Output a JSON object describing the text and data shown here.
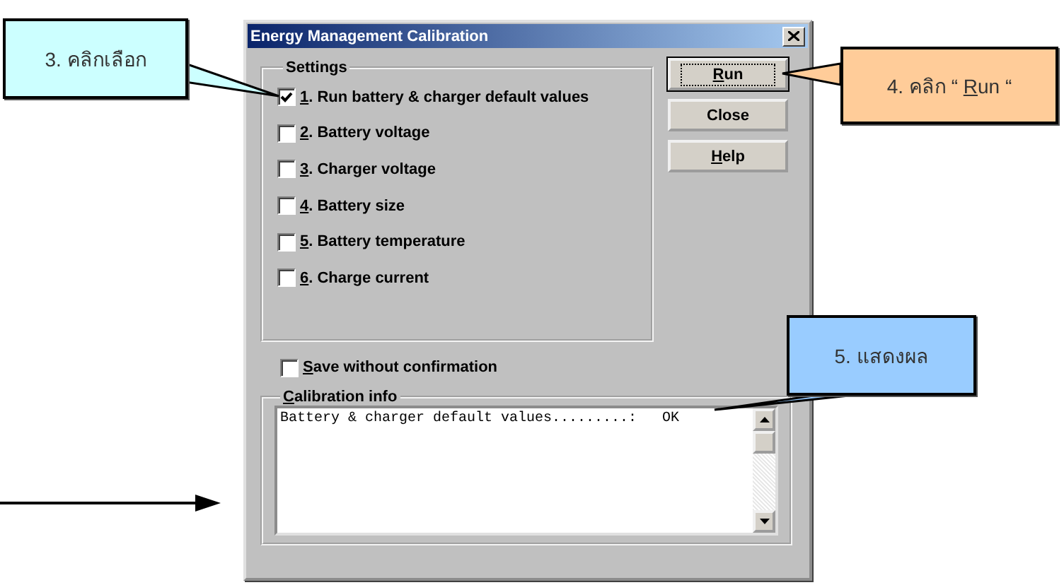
{
  "window": {
    "title": "Energy Management Calibration"
  },
  "settings": {
    "title": "Settings",
    "options": [
      {
        "mnemonic": "1",
        "rest": ". Run battery & charger default values",
        "checked": true
      },
      {
        "mnemonic": "2",
        "rest": ". Battery voltage",
        "checked": false
      },
      {
        "mnemonic": "3",
        "rest": ". Charger voltage",
        "checked": false
      },
      {
        "mnemonic": "4",
        "rest": ". Battery size",
        "checked": false
      },
      {
        "mnemonic": "5",
        "rest": ". Battery temperature",
        "checked": false
      },
      {
        "mnemonic": "6",
        "rest": ". Charge current",
        "checked": false
      }
    ]
  },
  "buttons": [
    {
      "mnemonic": "R",
      "rest": "un",
      "default": true
    },
    {
      "rest": "Close",
      "default": false
    },
    {
      "mnemonic": "H",
      "rest": "elp",
      "default": false
    }
  ],
  "save_option": {
    "mnemonic": "S",
    "rest": "ave without confirmation",
    "checked": false
  },
  "calibration_info": {
    "mnemonic": "C",
    "rest": "alibration info",
    "lines": [
      "Battery & charger default values.........:   OK"
    ]
  },
  "callouts": [
    {
      "lead": "3. คลิกเลือก",
      "color": "#ccffff"
    },
    {
      "lead": "4. คลิก “ ",
      "mnemonic": "R",
      "rest": "un “",
      "color": "#ffcc99"
    },
    {
      "lead": "5. แสดงผล",
      "color": "#99ccff"
    }
  ]
}
